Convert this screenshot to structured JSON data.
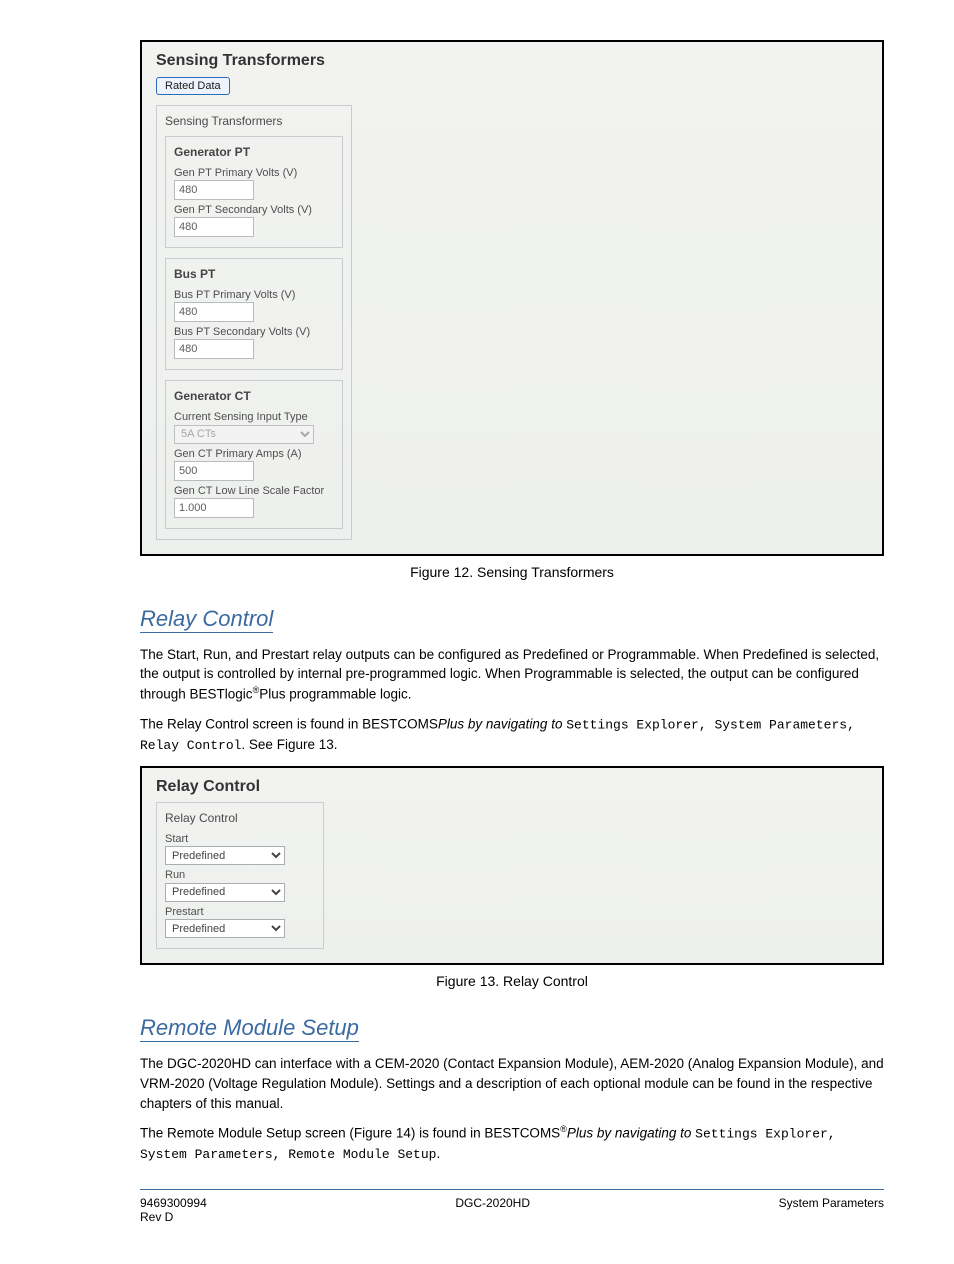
{
  "sensing": {
    "title": "Sensing Transformers",
    "tab_label": "Rated Data",
    "group_label": "Sensing Transformers",
    "generator_pt": {
      "legend": "Generator PT",
      "primary_label": "Gen PT Primary Volts (V)",
      "primary_value": "480",
      "secondary_label": "Gen PT Secondary Volts (V)",
      "secondary_value": "480"
    },
    "bus_pt": {
      "legend": "Bus PT",
      "primary_label": "Bus PT Primary Volts (V)",
      "primary_value": "480",
      "secondary_label": "Bus PT Secondary Volts (V)",
      "secondary_value": "480"
    },
    "generator_ct": {
      "legend": "Generator CT",
      "type_label": "Current Sensing Input Type",
      "type_value": "5A CTs",
      "primary_label": "Gen CT Primary Amps (A)",
      "primary_value": "500",
      "scale_label": "Gen CT Low Line Scale Factor",
      "scale_value": "1.000"
    }
  },
  "figure12": "Figure 12. Sensing Transformers",
  "relay_section": {
    "heading": "Relay Control",
    "para": "The Start, Run, and Prestart relay outputs can be configured as Predefined or Programmable. When Predefined is selected, the output is controlled by internal pre-programmed logic. When Programmable is selected, the output can be configured through BESTlogic",
    "para_suffix": "Plus programmable logic.",
    "path_intro": "The Relay Control screen is found in BESTCOMS",
    "path_suffix": "Plus by navigating to ",
    "path_value": "Settings Explorer, System Parameters, Relay Control",
    "fig_ref": ". See Figure 13."
  },
  "relay": {
    "title": "Relay Control",
    "group_label": "Relay Control",
    "start_label": "Start",
    "start_value": "Predefined",
    "run_label": "Run",
    "run_value": "Predefined",
    "prestart_label": "Prestart",
    "prestart_value": "Predefined"
  },
  "figure13": "Figure 13. Relay Control",
  "remote_section": {
    "heading": "Remote Module Setup",
    "para1": "The DGC-2020HD can interface with a CEM-2020 (Contact Expansion Module), AEM-2020 (Analog Expansion Module), and VRM-2020 (Voltage Regulation Module). Settings and a description of each optional module can be found in the respective chapters of this manual.",
    "path_intro": "The Remote Module Setup screen (Figure 14) is found in BESTCOMS",
    "path_suffix": "Plus by navigating to ",
    "path_value": "Settings Explorer, System Parameters, Remote Module Setup",
    "tail": "."
  },
  "footer": {
    "left": "9469300994",
    "center": "DGC-2020HD",
    "right": "System Parameters",
    "rev": "Rev D"
  }
}
